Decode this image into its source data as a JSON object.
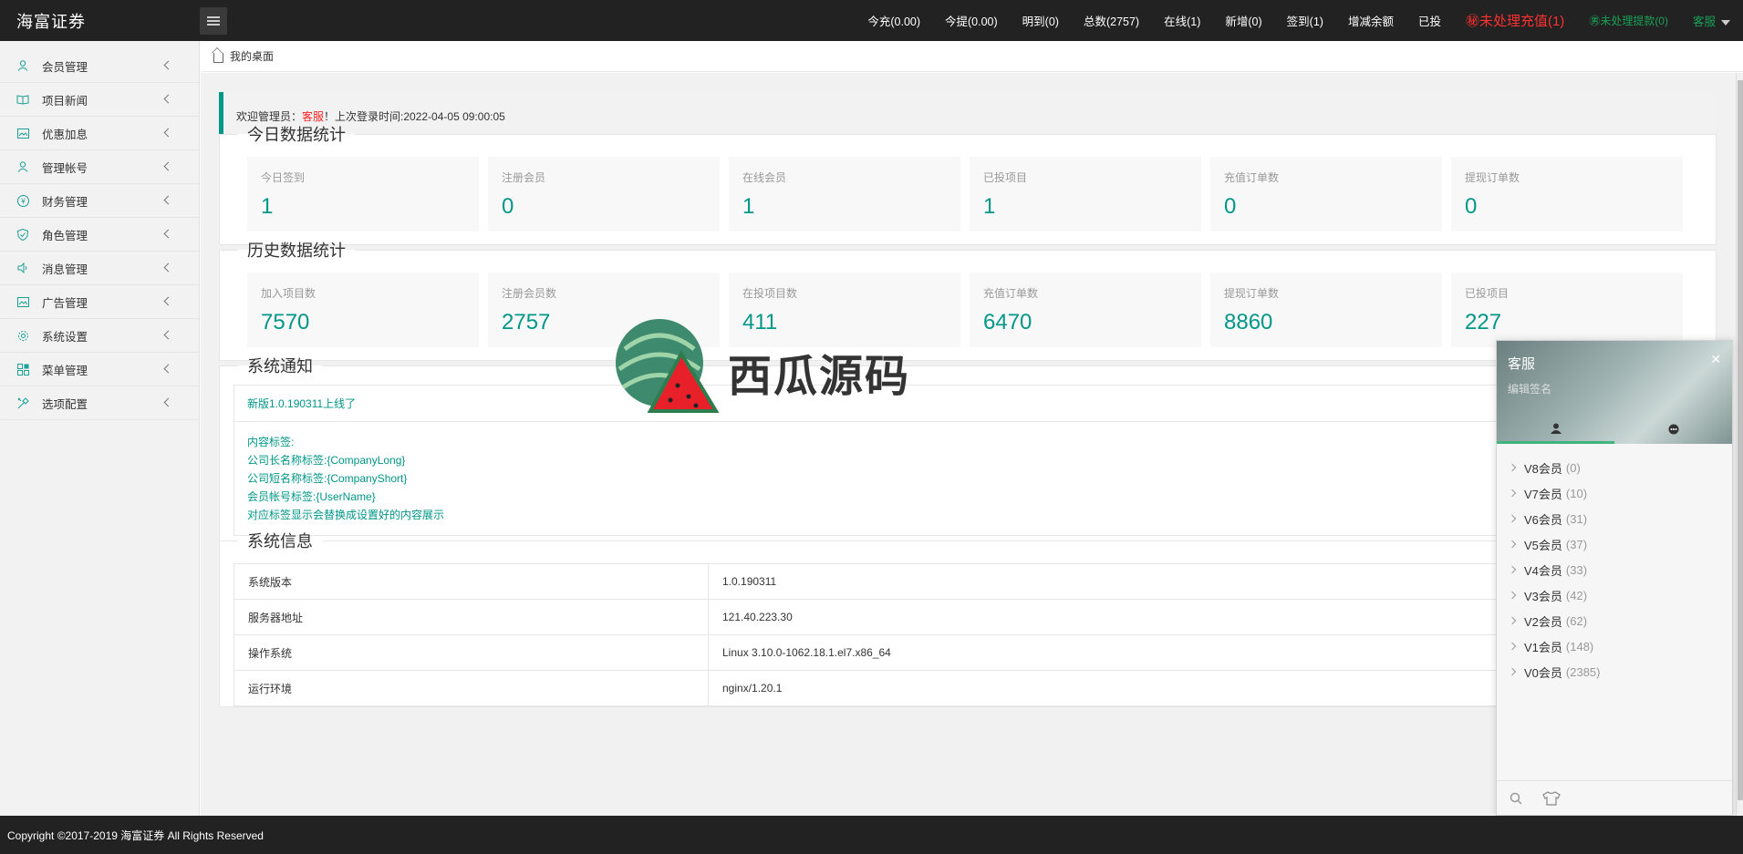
{
  "app": {
    "title": "海富证券"
  },
  "topnav": [
    {
      "label": "今充(0.00)",
      "style": "normal"
    },
    {
      "label": "今提(0.00)",
      "style": "normal"
    },
    {
      "label": "明到(0)",
      "style": "normal"
    },
    {
      "label": "总数(2757)",
      "style": "normal"
    },
    {
      "label": "在线(1)",
      "style": "normal"
    },
    {
      "label": "新增(0)",
      "style": "normal"
    },
    {
      "label": "签到(1)",
      "style": "normal"
    },
    {
      "label": "增减余额",
      "style": "normal"
    },
    {
      "label": "已投",
      "style": "normal"
    },
    {
      "label": "㊙未处理充值(1)",
      "style": "alert"
    },
    {
      "label": "㊚未处理提款(0)",
      "style": "green"
    },
    {
      "label": "客服",
      "style": "user"
    }
  ],
  "sidebar": {
    "items": [
      {
        "label": "会员管理",
        "icon": "user-icon"
      },
      {
        "label": "项目新闻",
        "icon": "book-icon"
      },
      {
        "label": "优惠加息",
        "icon": "picture-icon"
      },
      {
        "label": "管理帐号",
        "icon": "user-icon"
      },
      {
        "label": "财务管理",
        "icon": "rmb-icon"
      },
      {
        "label": "角色管理",
        "icon": "shield-icon"
      },
      {
        "label": "消息管理",
        "icon": "speaker-icon"
      },
      {
        "label": "广告管理",
        "icon": "picture-icon"
      },
      {
        "label": "系统设置",
        "icon": "gear-icon"
      },
      {
        "label": "菜单管理",
        "icon": "app-grid-icon"
      },
      {
        "label": "选项配置",
        "icon": "tools-icon"
      }
    ]
  },
  "breadcrumb": {
    "label": "我的桌面"
  },
  "welcome": {
    "prefix": "欢迎管理员：",
    "name": "客服",
    "suffix": "！上次登录时间:2022-04-05 09:00:05"
  },
  "today_stats": {
    "title": "今日数据统计",
    "items": [
      {
        "label": "今日签到",
        "value": "1"
      },
      {
        "label": "注册会员",
        "value": "0"
      },
      {
        "label": "在线会员",
        "value": "1"
      },
      {
        "label": "已投项目",
        "value": "1"
      },
      {
        "label": "充值订单数",
        "value": "0"
      },
      {
        "label": "提现订单数",
        "value": "0"
      }
    ]
  },
  "history_stats": {
    "title": "历史数据统计",
    "items": [
      {
        "label": "加入项目数",
        "value": "7570"
      },
      {
        "label": "注册会员数",
        "value": "2757"
      },
      {
        "label": "在投项目数",
        "value": "411"
      },
      {
        "label": "充值订单数",
        "value": "6470"
      },
      {
        "label": "提现订单数",
        "value": "8860"
      },
      {
        "label": "已投项目",
        "value": "227"
      }
    ]
  },
  "notice": {
    "title": "系统通知",
    "headline": "新版1.0.190311上线了",
    "lines": [
      "内容标签:",
      "公司长名称标签:{CompanyLong}",
      "公司短名称标签:{CompanyShort}",
      "会员帐号标签:{UserName}",
      "对应标签显示会替换成设置好的内容展示"
    ]
  },
  "sysinfo": {
    "title": "系统信息",
    "rows": [
      {
        "key": "系统版本",
        "value": "1.0.190311"
      },
      {
        "key": "服务器地址",
        "value": "121.40.223.30"
      },
      {
        "key": "操作系统",
        "value": "Linux 3.10.0-1062.18.1.el7.x86_64"
      },
      {
        "key": "运行环境",
        "value": "nginx/1.20.1"
      }
    ]
  },
  "footer": {
    "text": "Copyright ©2017-2019 海富证券 All Rights Reserved"
  },
  "watermark": {
    "text": "西瓜源码"
  },
  "im": {
    "name": "客服",
    "sign": "编辑签名",
    "groups": [
      {
        "name": "V8会员",
        "count": "(0)"
      },
      {
        "name": "V7会员",
        "count": "(10)"
      },
      {
        "name": "V6会员",
        "count": "(31)"
      },
      {
        "name": "V5会员",
        "count": "(37)"
      },
      {
        "name": "V4会员",
        "count": "(33)"
      },
      {
        "name": "V3会员",
        "count": "(42)"
      },
      {
        "name": "V2会员",
        "count": "(62)"
      },
      {
        "name": "V1会员",
        "count": "(148)"
      },
      {
        "name": "V0会员",
        "count": "(2385)"
      }
    ]
  },
  "colors": {
    "accent": "#009688",
    "alert": "#ff3030",
    "topbar": "#222222",
    "im_tab": "#3fb57d"
  }
}
